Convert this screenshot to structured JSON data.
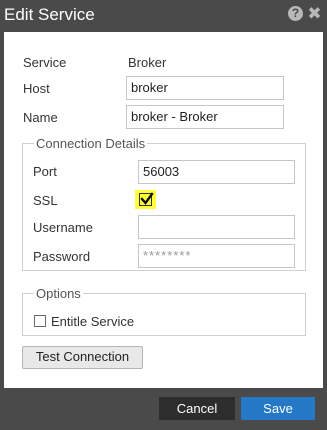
{
  "dialog": {
    "title": "Edit Service",
    "help_icon": "?",
    "close_icon": "✖"
  },
  "form": {
    "service_label": "Service",
    "service_value": "Broker",
    "host_label": "Host",
    "host_value": "broker",
    "name_label": "Name",
    "name_value": "broker - Broker"
  },
  "connection": {
    "legend": "Connection Details",
    "port_label": "Port",
    "port_value": "56003",
    "ssl_label": "SSL",
    "ssl_checked": true,
    "username_label": "Username",
    "username_value": "",
    "password_label": "Password",
    "password_value": "********"
  },
  "options": {
    "legend": "Options",
    "entitle_label": "Entitle Service",
    "entitle_checked": false
  },
  "buttons": {
    "test_connection": "Test Connection",
    "cancel": "Cancel",
    "save": "Save"
  },
  "colors": {
    "titlebar": "#4a4a4a",
    "save": "#2478c6",
    "cancel": "#2d2d2d",
    "highlight": "#ffff3a"
  }
}
